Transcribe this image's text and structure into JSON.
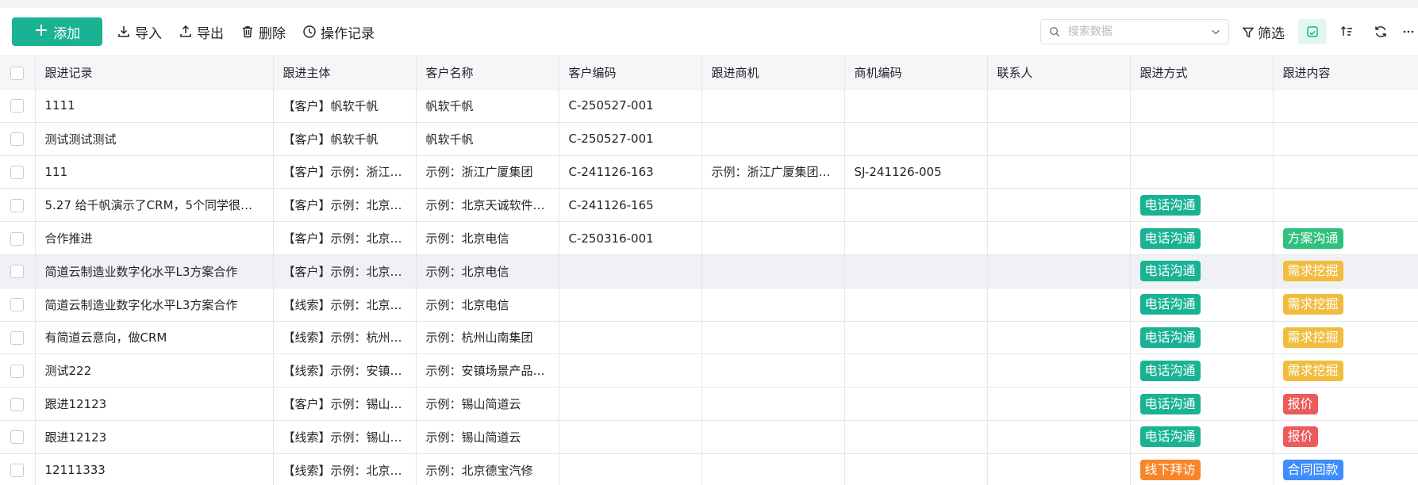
{
  "toolbar": {
    "add_label": "添加",
    "import_label": "导入",
    "export_label": "导出",
    "delete_label": "删除",
    "log_label": "操作记录",
    "search_placeholder": "搜索数据",
    "filter_label": "筛选"
  },
  "colors": {
    "accent": "#19b394",
    "tag_phone": "#19b394",
    "tag_plan": "#2fc17e",
    "tag_need": "#f0bd3f",
    "tag_quote": "#ed5a5a",
    "tag_visit": "#f7862a",
    "tag_payment": "#3f8cfc"
  },
  "table": {
    "headers": [
      "跟进记录",
      "跟进主体",
      "客户名称",
      "客户编码",
      "跟进商机",
      "商机编码",
      "联系人",
      "跟进方式",
      "跟进内容"
    ],
    "rows": [
      {
        "record": "1111",
        "subject": "【客户】帆软千帆",
        "customer": "帆软千帆",
        "code": "C-250527-001",
        "opp": "",
        "opp_code": "",
        "contact": "",
        "method": "",
        "content": ""
      },
      {
        "record": "测试测试测试",
        "subject": "【客户】帆软千帆",
        "customer": "帆软千帆",
        "code": "C-250527-001",
        "opp": "",
        "opp_code": "",
        "contact": "",
        "method": "",
        "content": ""
      },
      {
        "record": "111",
        "subject": "【客户】示例：浙江…",
        "customer": "示例：浙江广厦集团",
        "code": "C-241126-163",
        "opp": "示例：浙江广厦集团…",
        "opp_code": "SJ-241126-005",
        "contact": "",
        "method": "",
        "content": ""
      },
      {
        "record": "5.27 给千帆演示了CRM，5个同学很有…",
        "subject": "【客户】示例：北京…",
        "customer": "示例：北京天诚软件…",
        "code": "C-241126-165",
        "opp": "",
        "opp_code": "",
        "contact": "",
        "method": "电话沟通",
        "content": ""
      },
      {
        "record": "合作推进",
        "subject": "【客户】示例：北京…",
        "customer": "示例：北京电信",
        "code": "C-250316-001",
        "opp": "",
        "opp_code": "",
        "contact": "",
        "method": "电话沟通",
        "content": "方案沟通"
      },
      {
        "record": "简道云制造业数字化水平L3方案合作",
        "subject": "【客户】示例：北京…",
        "customer": "示例：北京电信",
        "code": "",
        "opp": "",
        "opp_code": "",
        "contact": "",
        "method": "电话沟通",
        "content": "需求挖掘"
      },
      {
        "record": "简道云制造业数字化水平L3方案合作",
        "subject": "【线索】示例：北京…",
        "customer": "示例：北京电信",
        "code": "",
        "opp": "",
        "opp_code": "",
        "contact": "",
        "method": "电话沟通",
        "content": "需求挖掘"
      },
      {
        "record": "有简道云意向，做CRM",
        "subject": "【线索】示例：杭州…",
        "customer": "示例：杭州山南集团",
        "code": "",
        "opp": "",
        "opp_code": "",
        "contact": "",
        "method": "电话沟通",
        "content": "需求挖掘"
      },
      {
        "record": "测试222",
        "subject": "【线索】示例：安镇…",
        "customer": "示例：安镇场景产品…",
        "code": "",
        "opp": "",
        "opp_code": "",
        "contact": "",
        "method": "电话沟通",
        "content": "需求挖掘"
      },
      {
        "record": "跟进12123",
        "subject": "【客户】示例：锡山…",
        "customer": "示例：锡山简道云",
        "code": "",
        "opp": "",
        "opp_code": "",
        "contact": "",
        "method": "电话沟通",
        "content": "报价"
      },
      {
        "record": "跟进12123",
        "subject": "【线索】示例：锡山…",
        "customer": "示例：锡山简道云",
        "code": "",
        "opp": "",
        "opp_code": "",
        "contact": "",
        "method": "电话沟通",
        "content": "报价"
      },
      {
        "record": "12111333",
        "subject": "【线索】示例：北京…",
        "customer": "示例：北京德宝汽修",
        "code": "",
        "opp": "",
        "opp_code": "",
        "contact": "",
        "method": "线下拜访",
        "content": "合同回款"
      }
    ]
  }
}
